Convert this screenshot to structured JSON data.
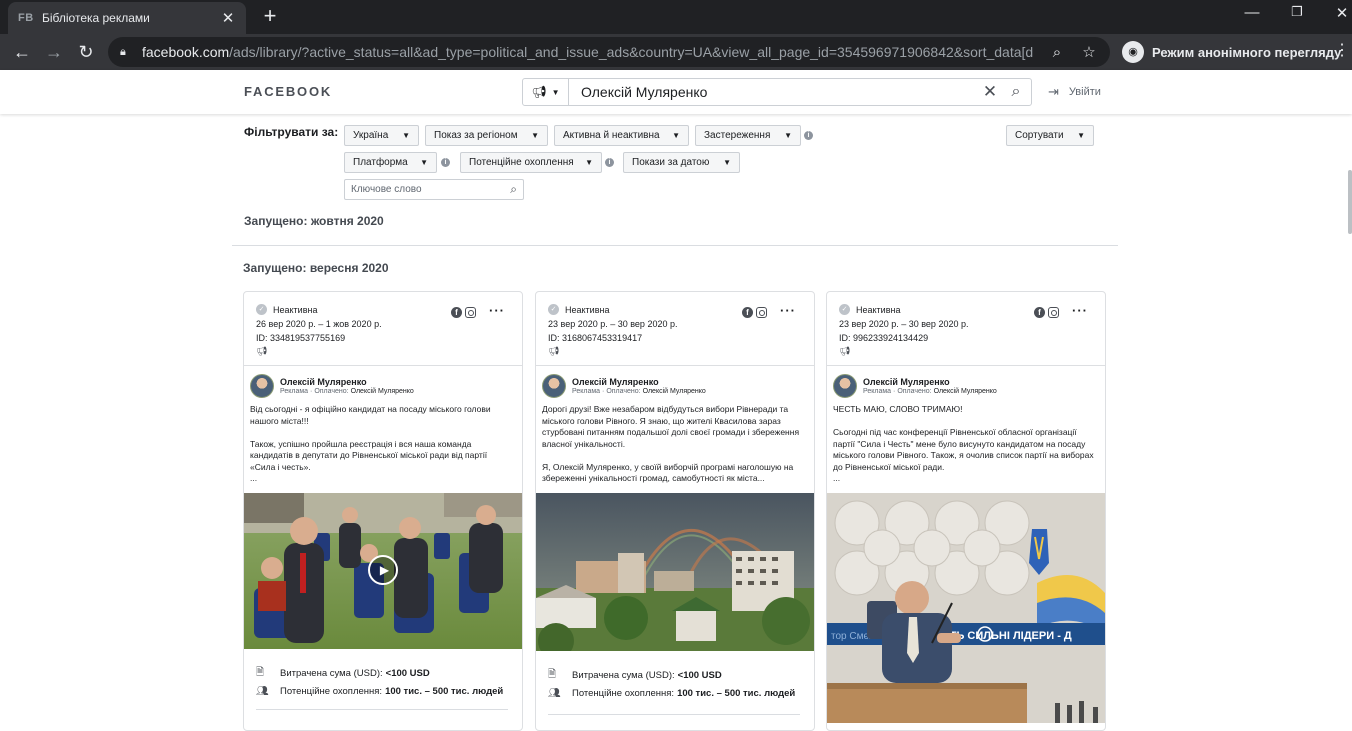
{
  "browser": {
    "tab_favicon": "FB",
    "tab_title": "Бібліотека реклами",
    "url_host": "facebook.com",
    "url_path": "/ads/library/?active_status=all&ad_type=political_and_issue_ads&country=UA&view_all_page_id=354596971906842&sort_data[di...",
    "incognito_label": "Режим анонімного перегляду"
  },
  "header": {
    "logo": "FACEBOOK",
    "search_value": "Олексій Муляренко",
    "logout_label": "Увійти"
  },
  "filters": {
    "label": "Фільтрувати за:",
    "country": "Україна",
    "region": "Показ за регіоном",
    "status": "Активна й неактивна",
    "disclaimer": "Застереження",
    "sort": "Сортувати",
    "platform": "Платформа",
    "reach": "Потенційне охоплення",
    "date": "Покази за датою",
    "keyword_placeholder": "Ключове слово"
  },
  "sections": {
    "october": "Запущено: жовтня 2020",
    "september": "Запущено: вересня 2020"
  },
  "cards": [
    {
      "status": "Неактивна",
      "dates": "26 вер 2020 р. – 1 жов 2020 р.",
      "id": "ID: 334819537755169",
      "advertiser": "Олексій Муляренко",
      "sponsored_prefix": "Реклама",
      "paid_by_prefix": "· Оплачено:",
      "paid_by": "Олексій Муляренко",
      "text": "Від сьогодні - я офіційно кандидат на посаду міського голови нашого міста!!!\n\nТакож, успішно пройшла реєстрація і вся наша команда кандидатів в депутати до Рівненської міської ради від партії «Сила і честь».\n...",
      "spend_label": "Витрачена сума (USD):",
      "spend_value": "<100 USD",
      "reach_label": "Потенційне охоплення:",
      "reach_value": "100 тис. – 500 тис. людей",
      "media": "video"
    },
    {
      "status": "Неактивна",
      "dates": "23 вер 2020 р. – 30 вер 2020 р.",
      "id": "ID: 3168067453319417",
      "advertiser": "Олексій Муляренко",
      "sponsored_prefix": "Реклама",
      "paid_by_prefix": "· Оплачено:",
      "paid_by": "Олексій Муляренко",
      "text": "Дорогі друзі! Вже незабаром відбудуться вибори Рівнеради та міського голови Рівного. Я знаю, що жителі Квасилова зараз стурбовані питанням подальшої долі своєї громади і збереження власної унікальності.\n\nЯ, Олексій Муляренко, у своїй виборчій програмі наголошую на збереженні унікальності громад, самобутності як міста...",
      "spend_label": "Витрачена сума (USD):",
      "spend_value": "<100 USD",
      "reach_label": "Потенційне охоплення:",
      "reach_value": "100 тис. – 500 тис. людей",
      "media": "image"
    },
    {
      "status": "Неактивна",
      "dates": "23 вер 2020 р. – 30 вер 2020 р.",
      "id": "ID: 996233924134429",
      "advertiser": "Олексій Муляренко",
      "sponsored_prefix": "Реклама",
      "paid_by_prefix": "· Оплачено:",
      "paid_by": "Олексій Муляренко",
      "text": "ЧЕСТЬ МАЮ, СЛОВО ТРИМАЮ!\n\nСьогодні під час конференції Рівненської обласної організації партії \"Сила і Честь\" мене було висунуто кандидатом на посаду міського голови Рівного. Також, я очолив список партії на виборах до Рівненської міської ради.\n...",
      "banner_text": "ЧЕСТЬ   СИЛЬНІ ЛІДЕРИ - Д",
      "banner_left": "тор Смєн",
      "media": "image"
    }
  ],
  "colors": {
    "chrome_dark": "#202124",
    "chrome_mid": "#35363a",
    "fb_border": "#dddfe2",
    "text_primary": "#1c1e21",
    "text_secondary": "#606770"
  }
}
